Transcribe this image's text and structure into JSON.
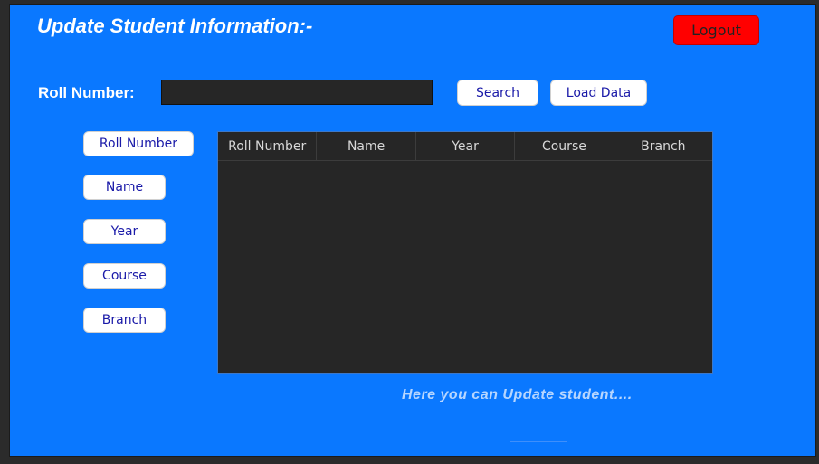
{
  "header": {
    "title": "Update Student Information:-",
    "logout_label": "Logout"
  },
  "search": {
    "roll_label": "Roll Number:",
    "roll_value": "",
    "search_label": "Search",
    "load_label": "Load Data"
  },
  "fields": {
    "roll_number": "Roll Number",
    "name": "Name",
    "year": "Year",
    "course": "Course",
    "branch": "Branch"
  },
  "table": {
    "columns": [
      "Roll Number",
      "Name",
      "Year",
      "Course",
      "Branch"
    ],
    "rows": []
  },
  "footer": {
    "message": "Here you can Update student...."
  },
  "colors": {
    "panel": "#0a78ff",
    "logout": "#ff0000",
    "table_bg": "#262626",
    "button_text": "#1a1aa8"
  }
}
